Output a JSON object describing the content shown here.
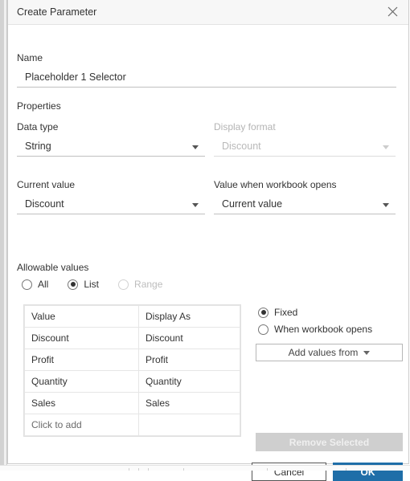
{
  "dialog": {
    "title": "Create Parameter",
    "close_icon": "close-icon"
  },
  "name_section": {
    "label": "Name",
    "value": "Placeholder 1 Selector",
    "placeholder": "Name"
  },
  "properties": {
    "heading": "Properties",
    "data_type": {
      "label": "Data type",
      "value": "String",
      "enabled": true
    },
    "display_format": {
      "label": "Display format",
      "value": "Discount",
      "enabled": false
    },
    "current_value": {
      "label": "Current value",
      "value": "Discount",
      "enabled": true
    },
    "value_when_workbook_opens": {
      "label": "Value when workbook opens",
      "value": "Current value",
      "enabled": true
    }
  },
  "allowable_values": {
    "heading": "Allowable values",
    "options": [
      {
        "label": "All",
        "selected": false,
        "enabled": true
      },
      {
        "label": "List",
        "selected": true,
        "enabled": true
      },
      {
        "label": "Range",
        "selected": false,
        "enabled": false
      }
    ]
  },
  "values_table": {
    "headers": [
      "Value",
      "Display As"
    ],
    "rows": [
      [
        "Discount",
        "Discount"
      ],
      [
        "Profit",
        "Profit"
      ],
      [
        "Quantity",
        "Quantity"
      ],
      [
        "Sales",
        "Sales"
      ]
    ],
    "add_row_label": "Click to add"
  },
  "list_source": {
    "options": [
      {
        "label": "Fixed",
        "selected": true
      },
      {
        "label": "When workbook opens",
        "selected": false
      }
    ],
    "add_values_from_label": "Add values from",
    "remove_selected_label": "Remove Selected",
    "remove_selected_enabled": false
  },
  "footer": {
    "cancel_label": "Cancel",
    "ok_label": "OK"
  },
  "colors": {
    "primary": "#1f6ea8",
    "titlebar_bg": "#f7f7f7",
    "disabled_text": "#b9b9b9",
    "disabled_button_bg": "#cfcfcf",
    "border": "#cccccc"
  }
}
